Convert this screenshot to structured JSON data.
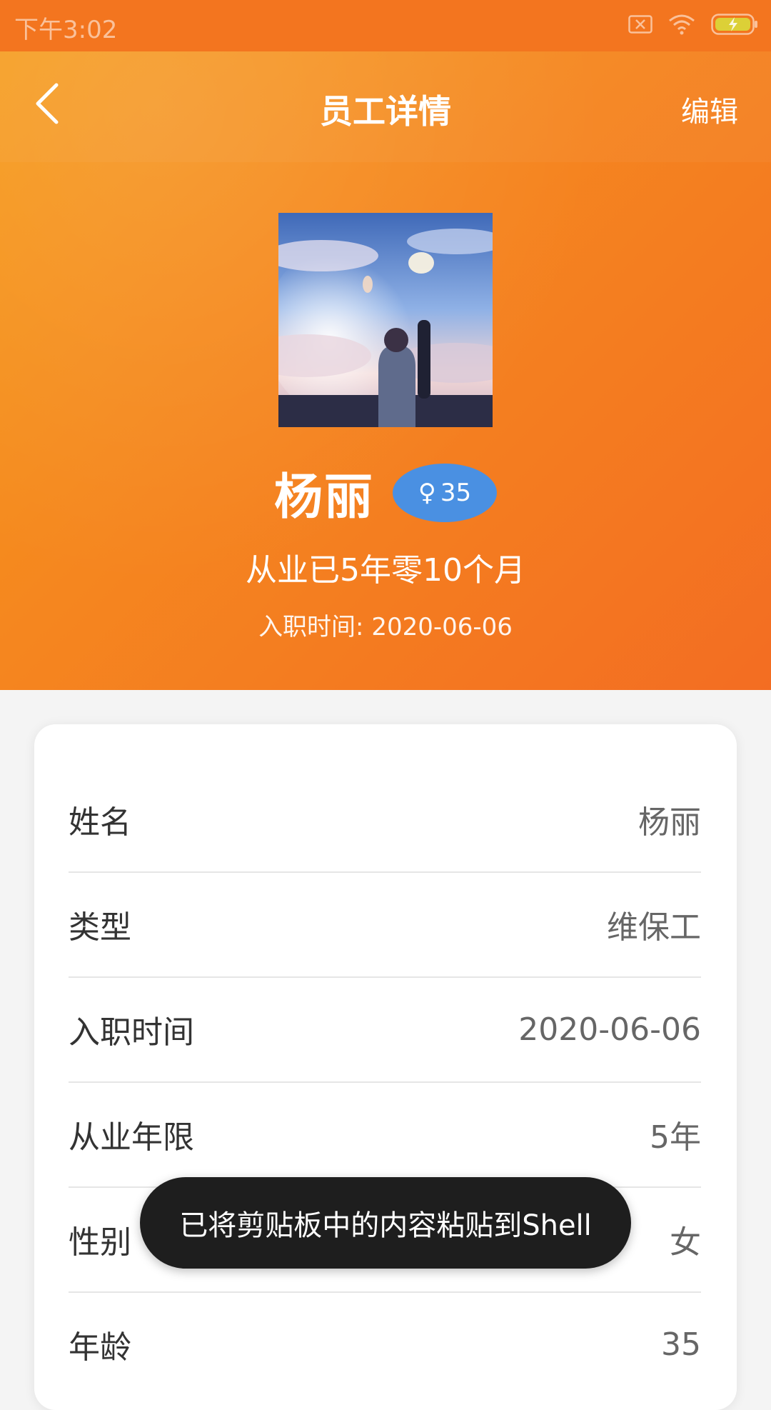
{
  "status_bar": {
    "time": "下午3:02"
  },
  "header": {
    "title": "员工详情",
    "edit_label": "编辑"
  },
  "profile": {
    "name": "杨丽",
    "gender_symbol": "♀",
    "age_badge": "35",
    "tenure_text": "从业已5年零10个月",
    "join_date_text": "入职时间: 2020-06-06"
  },
  "details": {
    "rows": [
      {
        "label": "姓名",
        "value": "杨丽"
      },
      {
        "label": "类型",
        "value": "维保工"
      },
      {
        "label": "入职时间",
        "value": "2020-06-06"
      },
      {
        "label": "从业年限",
        "value": "5年"
      },
      {
        "label": "性别",
        "value": "女"
      },
      {
        "label": "年龄",
        "value": "35"
      }
    ]
  },
  "toast": {
    "message": "已将剪贴板中的内容粘贴到Shell"
  },
  "colors": {
    "header_gradient_start": "#f59d1b",
    "header_gradient_end": "#f36d22",
    "gender_badge": "#4a90e2",
    "toast_background": "#1e1e1e",
    "page_background": "#f4f4f4"
  },
  "icons": {
    "back": "chevron-left-icon",
    "sim": "sim-error-icon",
    "wifi": "wifi-icon",
    "battery": "battery-charging-icon"
  }
}
